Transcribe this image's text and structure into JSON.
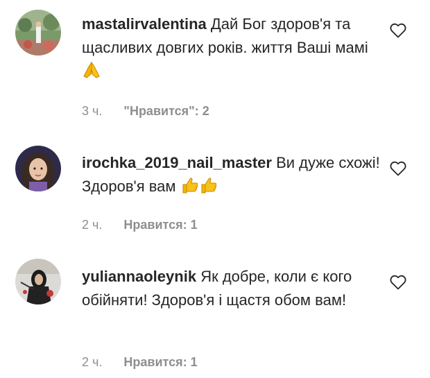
{
  "comments": [
    {
      "username": "mastalirvalentina",
      "text": "Дай Бог здоров'я та щасливих довгих років. життя Ваші мамі",
      "emojis": [
        "folded-hands"
      ],
      "time": "3 ч.",
      "likes": "\"Нравится\": 2"
    },
    {
      "username": "irochka_2019_nail_master",
      "text": "Ви дуже схожі! Здоров'я вам",
      "emojis": [
        "thumbs-up",
        "thumbs-up"
      ],
      "time": "2 ч.",
      "likes": "Нравится: 1"
    },
    {
      "username": "yuliannaoleynik",
      "text": "Як добре, коли є кого обійняти! Здоров'я і щастя обом вам!",
      "emojis": [],
      "time": "2 ч.",
      "likes": "Нравится: 1"
    }
  ],
  "icons": {
    "like": "heart-icon"
  },
  "colors": {
    "text": "#262626",
    "secondary": "#8e8e8e",
    "emoji": "#f5b400"
  }
}
